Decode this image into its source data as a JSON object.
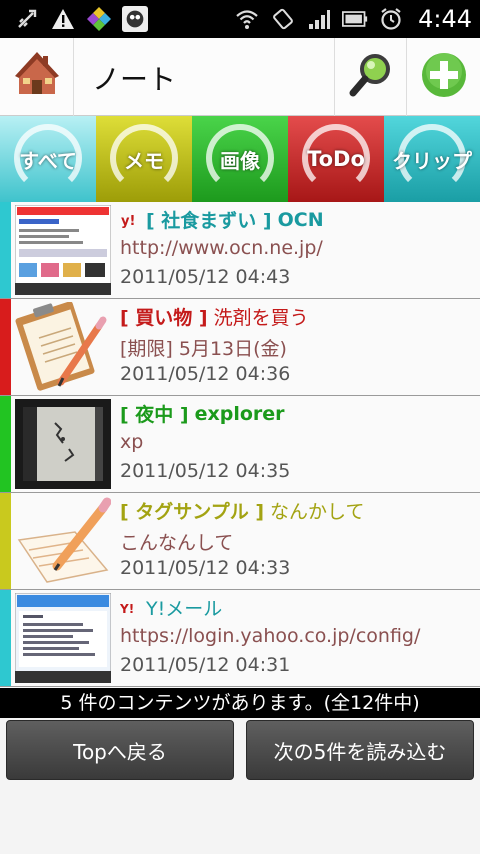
{
  "status_bar": {
    "icons_left": [
      "usb-icon",
      "warning-icon",
      "app-icon",
      "app-icon-2"
    ],
    "icons_right": [
      "wifi-icon",
      "rotate-icon",
      "signal-icon",
      "battery-icon",
      "alarm-icon"
    ],
    "time": "4:44"
  },
  "header": {
    "title": "ノート",
    "home_icon": "house-icon",
    "search_icon": "magnifier-icon",
    "add_icon": "plus-icon"
  },
  "tabs": [
    {
      "label": "すべて",
      "color": "#3fc3cc"
    },
    {
      "label": "メモ",
      "color": "#b3b313"
    },
    {
      "label": "画像",
      "color": "#2aa82a"
    },
    {
      "label": "ToDo",
      "color": "#c42020"
    },
    {
      "label": "クリップ",
      "color": "#2ab0b7"
    }
  ],
  "items": [
    {
      "tag": "[ 社食まずい ]",
      "title": "OCN",
      "line2": "http://www.ocn.ne.jp/",
      "date": "2011/05/12 04:43",
      "bar_color": "#2ec8d0",
      "tag_color": "#1a9aa0",
      "title_color": "#1a9aa0",
      "title_bold": true
    },
    {
      "tag": "[ 買い物 ]",
      "title": "洗剤を買う",
      "line2": "[期限] 5月13日(金)",
      "date": "2011/05/12 04:36",
      "bar_color": "#d81c1c",
      "tag_color": "#c41a1a",
      "title_color": "#c41a1a",
      "title_bold": false
    },
    {
      "tag": "[ 夜中 ]",
      "title": "explorer",
      "line2": "xp",
      "date": "2011/05/12 04:35",
      "bar_color": "#22c422",
      "tag_color": "#1b9a1b",
      "title_color": "#1b9a1b",
      "title_bold": true
    },
    {
      "tag": "[ タグサンプル ]",
      "title": "なんかして",
      "line2": "こんなんして",
      "date": "2011/05/12 04:33",
      "bar_color": "#c9c91e",
      "tag_color": "#a3a312",
      "title_color": "#a3a312",
      "title_bold": false
    },
    {
      "tag": "",
      "title": "Y!メール",
      "line2": "https://login.yahoo.co.jp/config/",
      "date": "2011/05/12 04:31",
      "bar_color": "#2ec8d0",
      "tag_color": "#1a9aa0",
      "title_color": "#1a9aa0",
      "title_bold": false
    }
  ],
  "footer": {
    "count_text": "5 件のコンテンツがあります。(全12件中)",
    "top_label": "Topへ戻る",
    "next_label": "次の5件を読み込む"
  }
}
